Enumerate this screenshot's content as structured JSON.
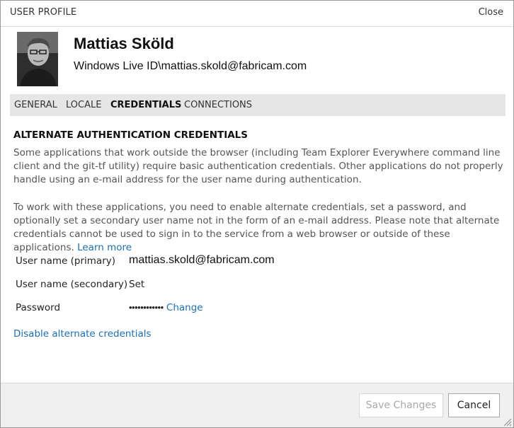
{
  "dialog": {
    "title": "USER PROFILE",
    "close_label": "Close"
  },
  "user": {
    "name": "Mattias Sköld",
    "identity": "Windows Live ID\\mattias.skold@fabricam.com"
  },
  "tabs": [
    {
      "label": "GENERAL",
      "active": false
    },
    {
      "label": "LOCALE",
      "active": false
    },
    {
      "label": "CREDENTIALS",
      "active": true
    },
    {
      "label": "CONNECTIONS",
      "active": false
    }
  ],
  "credentials": {
    "section_title": "ALTERNATE AUTHENTICATION CREDENTIALS",
    "description_1": "Some applications that work outside the browser (including Team Explorer Everywhere command line client and the git-tf utility) require basic authentication credentials. Other applications do not properly handle using an e-mail address for the user name during authentication.",
    "description_2": "To work with these applications, you need to enable alternate credentials, set a password, and optionally set a secondary user name not in the form of an e-mail address. Please note that alternate credentials cannot be used to sign in to the service from a web browser or outside of these applications.",
    "learn_more_label": "Learn more",
    "rows": {
      "primary_label": "User name (primary)",
      "primary_value": "mattias.skold@fabricam.com",
      "secondary_label": "User name (secondary)",
      "secondary_action": "Set",
      "password_label": "Password",
      "password_value": "••••••••••••",
      "password_action": "Change"
    },
    "disable_label": "Disable alternate credentials"
  },
  "footer": {
    "save_label": "Save Changes",
    "save_enabled": false,
    "cancel_label": "Cancel"
  },
  "colors": {
    "link": "#1a6fb5",
    "tab_bar": "#e6e6e6",
    "footer_bg": "#f0f0f0"
  }
}
